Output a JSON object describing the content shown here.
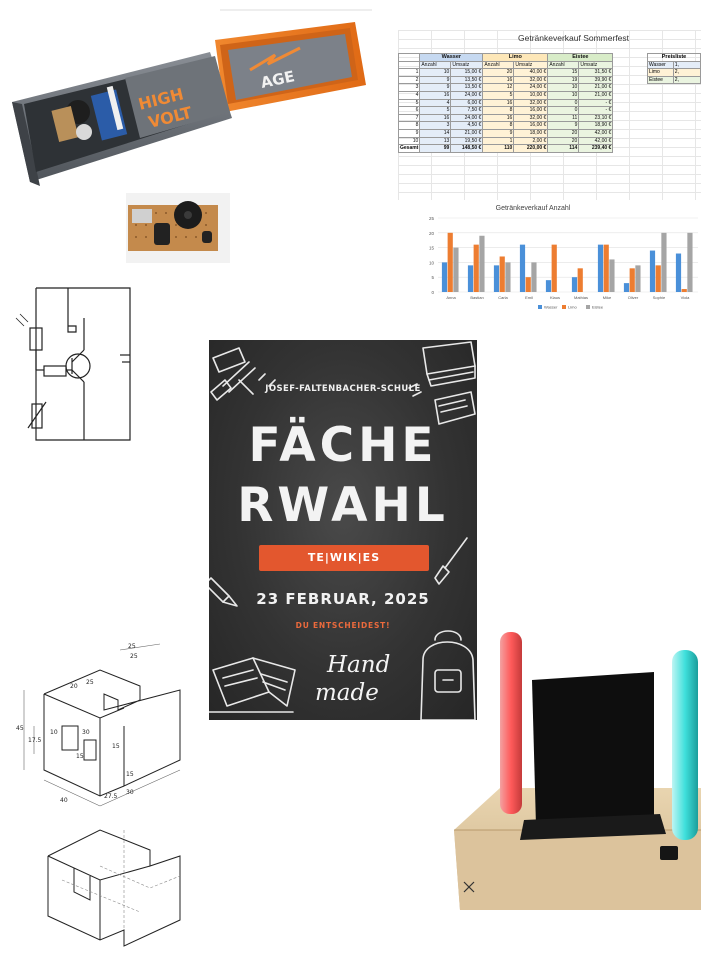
{
  "poster": {
    "school": "JOSEF-FALTENBACHER-SCHULE",
    "title_line1": "FÄCHE",
    "title_line2": "RWAHL",
    "subjects": "TE|WIK|ES",
    "date": "23 FEBRUAR, 2025",
    "tagline": "DU ENTSCHEIDEST!",
    "handmade_line1": "Hand",
    "handmade_line2": "made",
    "colors": {
      "background": "#333333",
      "accent": "#e3572e"
    }
  },
  "box_photo": {
    "label_line1": "HIGH",
    "label_line2": "VOLT",
    "label_line3": "AGE"
  },
  "spreadsheet": {
    "title": "Getränkeverkauf Sommerfest",
    "groups": [
      "Wasser",
      "Limo",
      "Eistee"
    ],
    "sub_headers": [
      "Anzahl",
      "Umsatz",
      "Anzahl",
      "Umsatz",
      "Anzahl",
      "Umsatz"
    ],
    "rows": [
      [
        "1",
        "10",
        "15,00 €",
        "20",
        "40,00 €",
        "15",
        "31,50 €"
      ],
      [
        "2",
        "9",
        "13,50 €",
        "16",
        "32,00 €",
        "19",
        "39,90 €"
      ],
      [
        "3",
        "9",
        "13,50 €",
        "12",
        "24,00 €",
        "10",
        "21,00 €"
      ],
      [
        "4",
        "16",
        "24,00 €",
        "5",
        "10,00 €",
        "10",
        "21,00 €"
      ],
      [
        "5",
        "4",
        "6,00 €",
        "16",
        "32,00 €",
        "0",
        "- €"
      ],
      [
        "6",
        "5",
        "7,50 €",
        "8",
        "16,00 €",
        "0",
        "- €"
      ],
      [
        "7",
        "16",
        "24,00 €",
        "16",
        "32,00 €",
        "11",
        "23,10 €"
      ],
      [
        "8",
        "3",
        "4,50 €",
        "8",
        "16,00 €",
        "9",
        "18,90 €"
      ],
      [
        "9",
        "14",
        "21,00 €",
        "9",
        "18,00 €",
        "20",
        "42,00 €"
      ],
      [
        "10",
        "13",
        "19,50 €",
        "1",
        "2,00 €",
        "20",
        "42,00 €"
      ]
    ],
    "total": [
      "Gesamt",
      "99",
      "148,50 €",
      "110",
      "220,00 €",
      "114",
      "239,40 €"
    ],
    "price_title": "Preisliste",
    "price_items": [
      {
        "name": "Wasser",
        "value": "1,"
      },
      {
        "name": "Limo",
        "value": "2,"
      },
      {
        "name": "Eistee",
        "value": "2,"
      }
    ]
  },
  "chart_data": {
    "type": "bar",
    "title": "Getränkeverkauf Anzahl",
    "categories": [
      "Anna",
      "Bastian",
      "Carla",
      "Emil",
      "Klaus",
      "Mathias",
      "Mike",
      "Oliver",
      "Sophie",
      "Viola"
    ],
    "series": [
      {
        "name": "Wasser",
        "values": [
          10,
          9,
          9,
          16,
          4,
          5,
          16,
          3,
          14,
          13
        ],
        "color": "#4a90d9"
      },
      {
        "name": "Limo",
        "values": [
          20,
          16,
          12,
          5,
          16,
          8,
          16,
          8,
          9,
          1
        ],
        "color": "#ed7d31"
      },
      {
        "name": "Eistee",
        "values": [
          15,
          19,
          10,
          10,
          0,
          0,
          11,
          9,
          20,
          20
        ],
        "color": "#a5a5a5"
      }
    ],
    "yticks": [
      "0",
      "5",
      "10",
      "15",
      "20",
      "25"
    ],
    "ylim": [
      0,
      25
    ],
    "grid": true,
    "legend": "bottom"
  },
  "drawing": {
    "dims_front": [
      "45",
      "17.5",
      "10",
      "30",
      "15",
      "40",
      "27.5",
      "15",
      "30",
      "15",
      "25",
      "20"
    ],
    "dims_top": [
      "25",
      "25"
    ]
  }
}
